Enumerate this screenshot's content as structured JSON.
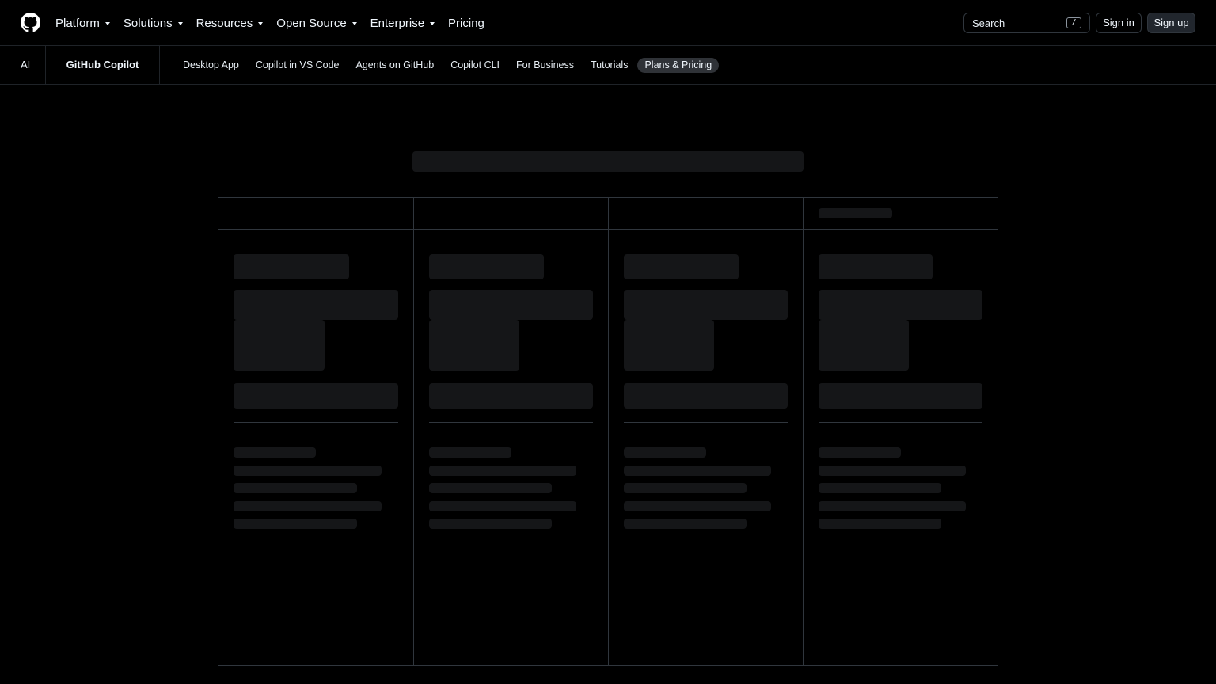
{
  "header": {
    "logo_icon": "github-mark-icon",
    "nav": [
      {
        "label": "Platform",
        "has_dropdown": true
      },
      {
        "label": "Solutions",
        "has_dropdown": true
      },
      {
        "label": "Resources",
        "has_dropdown": true
      },
      {
        "label": "Open Source",
        "has_dropdown": true
      },
      {
        "label": "Enterprise",
        "has_dropdown": true
      },
      {
        "label": "Pricing",
        "has_dropdown": false
      }
    ],
    "search": {
      "placeholder": "Search",
      "shortcut": "/"
    },
    "sign_in": "Sign in",
    "sign_up": "Sign up"
  },
  "subnav": {
    "section": "AI",
    "product": "GitHub Copilot",
    "links": [
      {
        "label": "Desktop App",
        "active": false
      },
      {
        "label": "Copilot in VS Code",
        "active": false
      },
      {
        "label": "Agents on GitHub",
        "active": false
      },
      {
        "label": "Copilot CLI",
        "active": false
      },
      {
        "label": "For Business",
        "active": false
      },
      {
        "label": "Tutorials",
        "active": false
      },
      {
        "label": "Plans & Pricing",
        "active": true
      }
    ]
  },
  "pricing": {
    "state": "loading",
    "plan_columns": 4
  },
  "colors": {
    "background": "#000000",
    "border": "#30363d",
    "skeleton": "#151618",
    "active_pill": "#2f3237",
    "text": "#f0f6fc"
  }
}
